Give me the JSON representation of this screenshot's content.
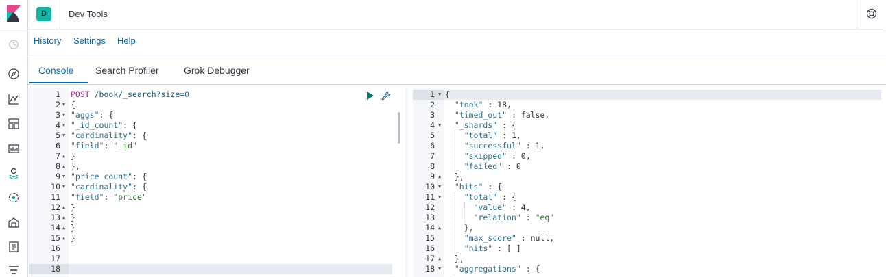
{
  "header": {
    "space_initial": "D",
    "title": "Dev Tools"
  },
  "top_menu": [
    "History",
    "Settings",
    "Help"
  ],
  "tabs": [
    "Console",
    "Search Profiler",
    "Grok Debugger"
  ],
  "request_lines": [
    {
      "n": "1",
      "f": "",
      "segs": [
        {
          "t": "POST",
          "c": "kw"
        },
        {
          "t": " /book/_search?size=0",
          "c": "txt"
        }
      ]
    },
    {
      "n": "2",
      "f": "down",
      "segs": [
        {
          "t": "{",
          "c": "pn"
        }
      ]
    },
    {
      "n": "3",
      "f": "down",
      "segs": [
        {
          "t": "\"aggs\"",
          "c": "str"
        },
        {
          "t": ": {",
          "c": "pn"
        }
      ]
    },
    {
      "n": "4",
      "f": "down",
      "segs": [
        {
          "t": "\"_id_count\"",
          "c": "str"
        },
        {
          "t": ": {",
          "c": "pn"
        }
      ]
    },
    {
      "n": "5",
      "f": "down",
      "segs": [
        {
          "t": "\"cardinality\"",
          "c": "str"
        },
        {
          "t": ": {",
          "c": "pn"
        }
      ]
    },
    {
      "n": "6",
      "f": "",
      "segs": [
        {
          "t": "\"field\"",
          "c": "str"
        },
        {
          "t": ": ",
          "c": "pn"
        },
        {
          "t": "\"_id\"",
          "c": "val"
        }
      ]
    },
    {
      "n": "7",
      "f": "up",
      "segs": [
        {
          "t": "}",
          "c": "pn"
        }
      ]
    },
    {
      "n": "8",
      "f": "up",
      "segs": [
        {
          "t": "},",
          "c": "pn"
        }
      ]
    },
    {
      "n": "9",
      "f": "down",
      "segs": [
        {
          "t": "\"price_count\"",
          "c": "str"
        },
        {
          "t": ": {",
          "c": "pn"
        }
      ]
    },
    {
      "n": "10",
      "f": "down",
      "segs": [
        {
          "t": "\"cardinality\"",
          "c": "str"
        },
        {
          "t": ": {",
          "c": "pn"
        }
      ]
    },
    {
      "n": "11",
      "f": "",
      "segs": [
        {
          "t": "\"field\"",
          "c": "str"
        },
        {
          "t": ": ",
          "c": "pn"
        },
        {
          "t": "\"price\"",
          "c": "val"
        }
      ]
    },
    {
      "n": "12",
      "f": "up",
      "segs": [
        {
          "t": "}",
          "c": "pn"
        }
      ]
    },
    {
      "n": "13",
      "f": "up",
      "segs": [
        {
          "t": "}",
          "c": "pn"
        }
      ]
    },
    {
      "n": "14",
      "f": "up",
      "segs": [
        {
          "t": "}",
          "c": "pn"
        }
      ]
    },
    {
      "n": "15",
      "f": "up",
      "segs": [
        {
          "t": "}",
          "c": "pn"
        }
      ]
    },
    {
      "n": "16",
      "f": "",
      "segs": []
    },
    {
      "n": "17",
      "f": "",
      "segs": []
    },
    {
      "n": "18",
      "f": "",
      "segs": []
    }
  ],
  "response_lines": [
    {
      "n": "1",
      "f": "down",
      "segs": [
        {
          "t": "{",
          "c": "pn"
        }
      ]
    },
    {
      "n": "2",
      "f": "",
      "segs": [
        {
          "t": "  \"took\"",
          "c": "str"
        },
        {
          "t": " : 18,",
          "c": "pn"
        }
      ]
    },
    {
      "n": "3",
      "f": "",
      "segs": [
        {
          "t": "  \"timed_out\"",
          "c": "str"
        },
        {
          "t": " : false,",
          "c": "pn"
        }
      ]
    },
    {
      "n": "4",
      "f": "down",
      "segs": [
        {
          "t": "  \"_shards\"",
          "c": "str"
        },
        {
          "t": " : {",
          "c": "pn"
        }
      ]
    },
    {
      "n": "5",
      "f": "",
      "segs": [
        {
          "t": "    \"total\"",
          "c": "str"
        },
        {
          "t": " : 1,",
          "c": "pn"
        }
      ]
    },
    {
      "n": "6",
      "f": "",
      "segs": [
        {
          "t": "    \"successful\"",
          "c": "str"
        },
        {
          "t": " : 1,",
          "c": "pn"
        }
      ]
    },
    {
      "n": "7",
      "f": "",
      "segs": [
        {
          "t": "    \"skipped\"",
          "c": "str"
        },
        {
          "t": " : 0,",
          "c": "pn"
        }
      ]
    },
    {
      "n": "8",
      "f": "",
      "segs": [
        {
          "t": "    \"failed\"",
          "c": "str"
        },
        {
          "t": " : 0",
          "c": "pn"
        }
      ]
    },
    {
      "n": "9",
      "f": "up",
      "segs": [
        {
          "t": "  },",
          "c": "pn"
        }
      ]
    },
    {
      "n": "10",
      "f": "down",
      "segs": [
        {
          "t": "  \"hits\"",
          "c": "str"
        },
        {
          "t": " : {",
          "c": "pn"
        }
      ]
    },
    {
      "n": "11",
      "f": "down",
      "segs": [
        {
          "t": "    \"total\"",
          "c": "str"
        },
        {
          "t": " : {",
          "c": "pn"
        }
      ]
    },
    {
      "n": "12",
      "f": "",
      "segs": [
        {
          "t": "      \"value\"",
          "c": "str"
        },
        {
          "t": " : 4,",
          "c": "pn"
        }
      ]
    },
    {
      "n": "13",
      "f": "",
      "segs": [
        {
          "t": "      \"relation\"",
          "c": "str"
        },
        {
          "t": " : ",
          "c": "pn"
        },
        {
          "t": "\"eq\"",
          "c": "val"
        }
      ]
    },
    {
      "n": "14",
      "f": "up",
      "segs": [
        {
          "t": "    },",
          "c": "pn"
        }
      ]
    },
    {
      "n": "15",
      "f": "",
      "segs": [
        {
          "t": "    \"max_score\"",
          "c": "str"
        },
        {
          "t": " : null,",
          "c": "pn"
        }
      ]
    },
    {
      "n": "16",
      "f": "",
      "segs": [
        {
          "t": "    \"hits\"",
          "c": "str"
        },
        {
          "t": " : [ ]",
          "c": "pn"
        }
      ]
    },
    {
      "n": "17",
      "f": "up",
      "segs": [
        {
          "t": "  },",
          "c": "pn"
        }
      ]
    },
    {
      "n": "18",
      "f": "down",
      "segs": [
        {
          "t": "  \"aggregations\"",
          "c": "str"
        },
        {
          "t": " : {",
          "c": "pn"
        }
      ]
    }
  ],
  "colors": {
    "accent": "#006bb4",
    "space_badge": "#16b5a8"
  },
  "icons": [
    "kibana-logo",
    "recent-icon",
    "discover-icon",
    "visualize-icon",
    "dashboard-icon",
    "canvas-icon",
    "maps-icon",
    "ml-icon",
    "infrastructure-icon",
    "logs-icon",
    "apm-icon",
    "help-icon",
    "run-icon",
    "wrench-icon"
  ]
}
